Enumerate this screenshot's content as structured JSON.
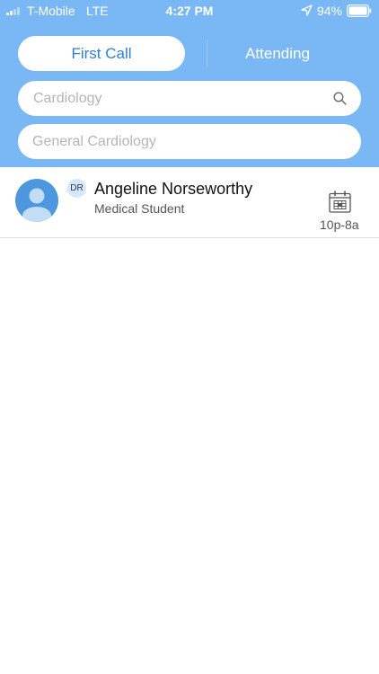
{
  "status_bar": {
    "carrier": "T-Mobile",
    "network": "LTE",
    "time": "4:27 PM",
    "battery": "94%",
    "battery_level": 0.94,
    "signal_bars": 2
  },
  "tabs": {
    "first_call": "First Call",
    "attending": "Attending"
  },
  "search": {
    "placeholder": "Cardiology"
  },
  "filter": {
    "placeholder": "General Cardiology"
  },
  "list": [
    {
      "badge": "DR",
      "name": "Angeline Norseworthy",
      "role": "Medical Student",
      "shift": "10p-8a"
    }
  ],
  "colors": {
    "header": "#7ab8f5",
    "accent": "#2f7fd6",
    "avatar": "#4d97de"
  }
}
